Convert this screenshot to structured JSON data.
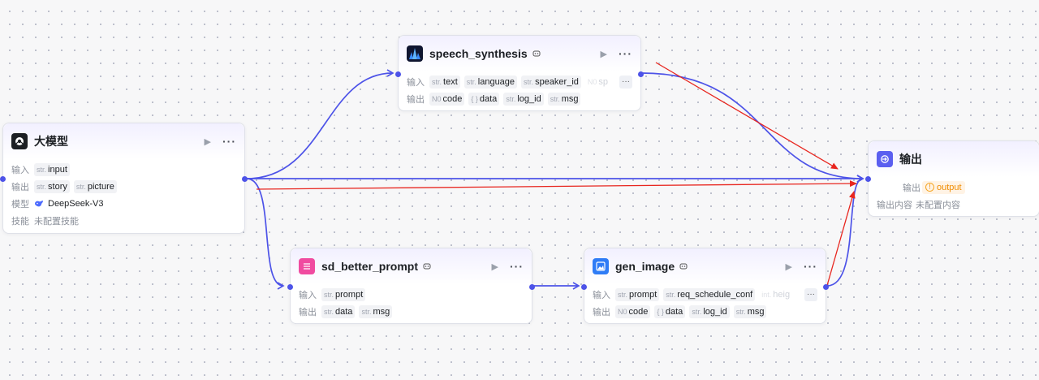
{
  "colors": {
    "accent": "#4d53e8",
    "annotation": "#e8261f",
    "llm_icon": "#1c1f23",
    "output_icon": "#5b5ff0",
    "prompt_icon": "#f04ba0",
    "image_icon": "#2f7cf6"
  },
  "nodes": {
    "llm": {
      "title": "大模型",
      "icon": "llm-icon",
      "input_label": "输入",
      "inputs": [
        {
          "type": "str.",
          "name": "input"
        }
      ],
      "output_label": "输出",
      "outputs": [
        {
          "type": "str.",
          "name": "story"
        },
        {
          "type": "str.",
          "name": "picture"
        }
      ],
      "model_label": "模型",
      "model": "DeepSeek-V3",
      "skill_label": "技能",
      "skill_value": "未配置技能"
    },
    "speech": {
      "title": "speech_synthesis",
      "icon": "audio-wave-icon",
      "input_label": "输入",
      "inputs": [
        {
          "type": "str.",
          "name": "text"
        },
        {
          "type": "str.",
          "name": "language"
        },
        {
          "type": "str.",
          "name": "speaker_id"
        },
        {
          "type": "N0",
          "name": "sp"
        }
      ],
      "output_label": "输出",
      "outputs": [
        {
          "type": "N0",
          "name": "code"
        },
        {
          "type": "{ }",
          "name": "data"
        },
        {
          "type": "str.",
          "name": "log_id"
        },
        {
          "type": "str.",
          "name": "msg"
        }
      ]
    },
    "prompt": {
      "title": "sd_better_prompt",
      "icon": "text-list-icon",
      "input_label": "输入",
      "inputs": [
        {
          "type": "str.",
          "name": "prompt"
        }
      ],
      "output_label": "输出",
      "outputs": [
        {
          "type": "str.",
          "name": "data"
        },
        {
          "type": "str.",
          "name": "msg"
        }
      ]
    },
    "image": {
      "title": "gen_image",
      "icon": "image-icon",
      "input_label": "输入",
      "inputs": [
        {
          "type": "str.",
          "name": "prompt"
        },
        {
          "type": "str.",
          "name": "req_schedule_conf"
        },
        {
          "type": "int.",
          "name": "heig"
        }
      ],
      "output_label": "输出",
      "outputs": [
        {
          "type": "N0",
          "name": "code"
        },
        {
          "type": "{ }",
          "name": "data"
        },
        {
          "type": "str.",
          "name": "log_id"
        },
        {
          "type": "str.",
          "name": "msg"
        }
      ]
    },
    "output": {
      "title": "输出",
      "icon": "output-icon",
      "output_label": "输出",
      "output_var": "output",
      "content_label": "输出内容",
      "content_value": "未配置内容"
    }
  },
  "controls": {
    "run": "▶",
    "more": "···",
    "ellipsis": "···"
  }
}
